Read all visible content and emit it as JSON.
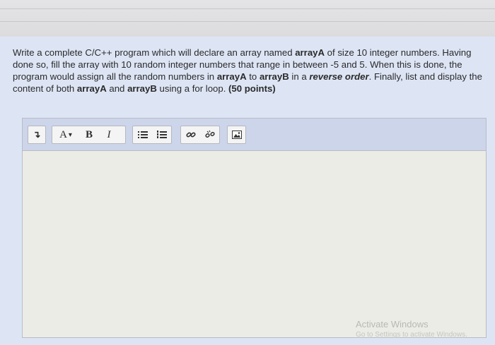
{
  "question": {
    "p1": "Write a complete C/C++ program which will declare an array named ",
    "b1": "arrayA",
    "p2": " of size 10 integer numbers. Having done so, fill the array with 10 random integer numbers that range in between -5 and 5. When this is done, the program would assign all the random numbers in ",
    "b2": "arrayA",
    "p3": " to ",
    "b3": "arrayB",
    "p4": " in a ",
    "em1": "reverse order",
    "p5": ". Finally, list and display the content of both ",
    "b4": "arrayA",
    "p6": " and ",
    "b5": "arrayB",
    "p7": " using a for loop. ",
    "points": "(50 points)"
  },
  "toolbar": {
    "format_glyph": "↴",
    "font_color_label": "A",
    "font_color_caret": "▾",
    "bold_label": "B",
    "italic_label": "I",
    "icons": [
      "format-icon",
      "font-color-icon",
      "bold-icon",
      "italic-icon",
      "bullet-list-icon",
      "numbered-list-icon",
      "link-icon",
      "unlink-icon",
      "image-icon"
    ]
  },
  "watermark": {
    "title": "Activate Windows",
    "subtitle": "Go to Settings to activate Windows."
  }
}
